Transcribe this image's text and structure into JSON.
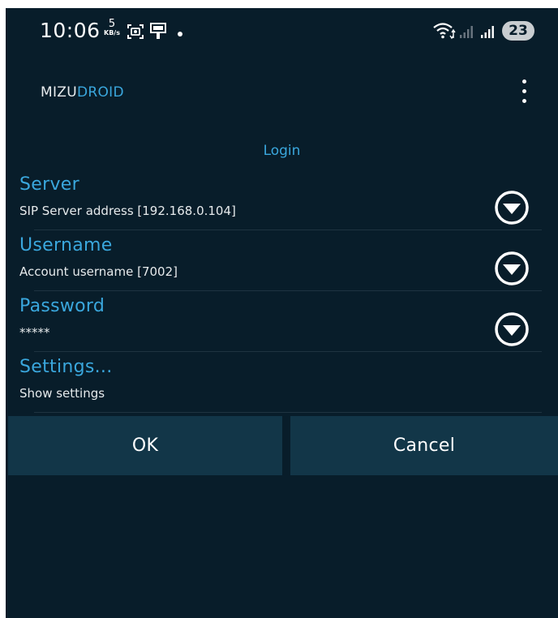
{
  "status_bar": {
    "time": "10:06",
    "net_speed_value": "5",
    "net_speed_unit": "KB/s",
    "battery": "23",
    "icons": [
      "screenshot-icon",
      "cast-icon",
      "wifi-icon",
      "signal-icon",
      "signal-icon"
    ]
  },
  "app_bar": {
    "title_part1": "MIZU",
    "title_part2": "DROID",
    "menu_icon": "overflow-menu-icon"
  },
  "dialog": {
    "title": "Login",
    "preferences": [
      {
        "title": "Server",
        "summary": "SIP Server address [192.168.0.104]",
        "has_dropdown": true
      },
      {
        "title": "Username",
        "summary": "Account username [7002]",
        "has_dropdown": true
      },
      {
        "title": "Password",
        "summary": "*****",
        "has_dropdown": true
      },
      {
        "title": "Settings...",
        "summary": "Show settings",
        "has_dropdown": false
      }
    ],
    "ok_label": "OK",
    "cancel_label": "Cancel"
  },
  "colors": {
    "background": "#081d2a",
    "accent": "#3aa7dd",
    "button": "#123648",
    "text": "#ffffff"
  }
}
